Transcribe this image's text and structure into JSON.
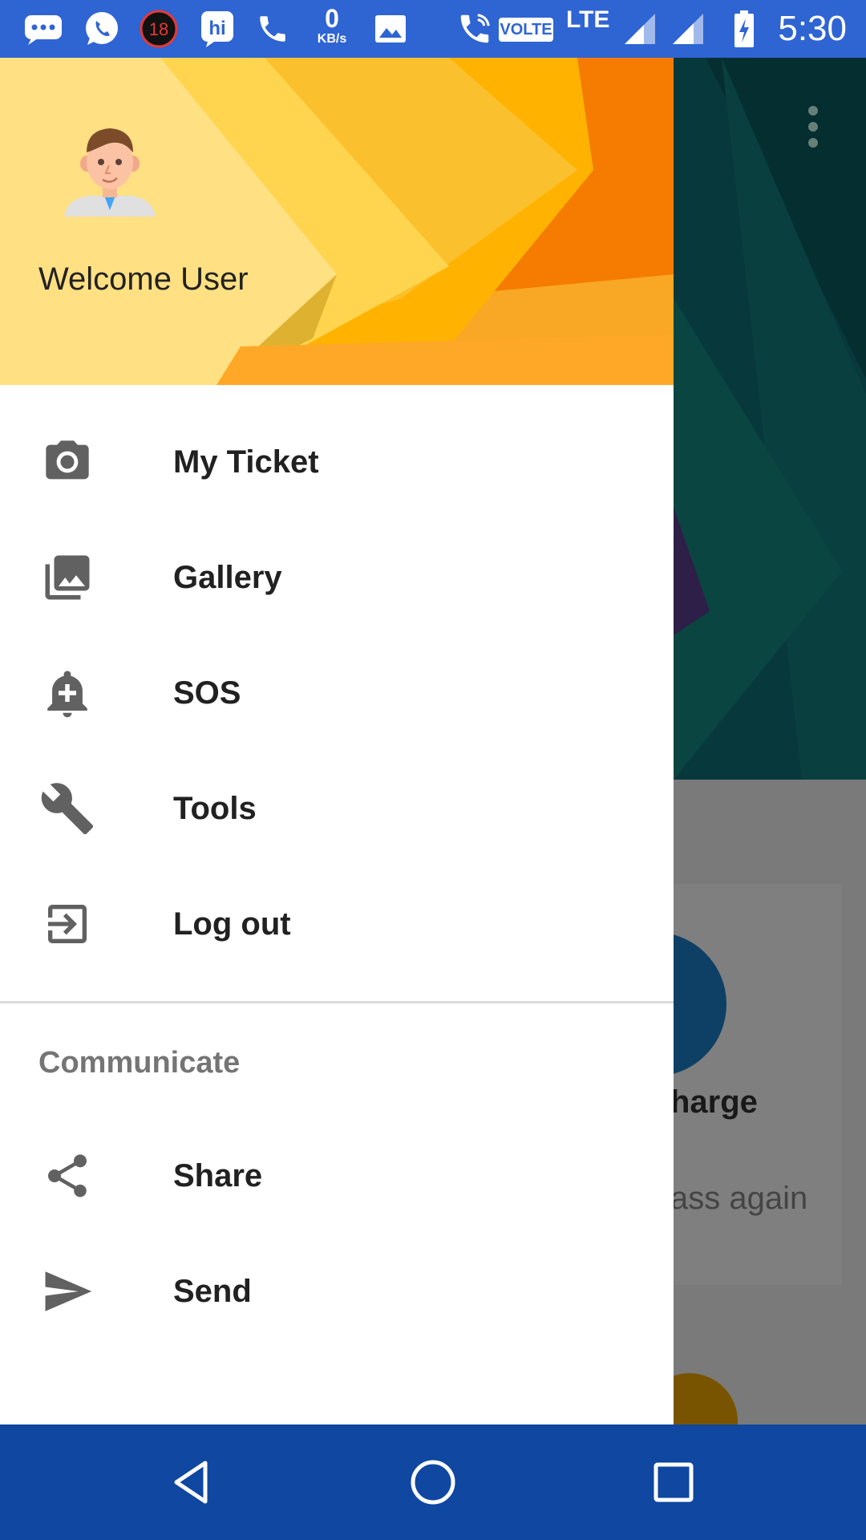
{
  "status_bar": {
    "time": "5:30",
    "notification_badge": "18",
    "net_speed_value": "0",
    "net_speed_unit": "KB/s",
    "volte": "VOLTE",
    "network": "LTE",
    "icons": [
      "chat-bubble-icon",
      "whatsapp-icon",
      "badge-18-icon",
      "hi-app-icon",
      "phone-icon",
      "image-icon",
      "wifi-calling-icon",
      "signal-icon",
      "signal-icon",
      "battery-charging-icon"
    ]
  },
  "drawer": {
    "header": {
      "welcome_text": "Welcome User",
      "avatar_icon": "user-avatar-icon"
    },
    "menu": [
      {
        "label": "My Ticket",
        "icon": "camera-icon"
      },
      {
        "label": "Gallery",
        "icon": "gallery-icon"
      },
      {
        "label": "SOS",
        "icon": "alarm-add-icon"
      },
      {
        "label": "Tools",
        "icon": "wrench-icon"
      },
      {
        "label": "Log out",
        "icon": "exit-icon"
      }
    ],
    "section_title": "Communicate",
    "communicate": [
      {
        "label": "Share",
        "icon": "share-icon"
      },
      {
        "label": "Send",
        "icon": "send-icon"
      }
    ]
  },
  "background": {
    "partial_text_1": "harge",
    "partial_text_2": "ass again"
  },
  "nav_bar": {
    "buttons": [
      "back-icon",
      "home-icon",
      "recents-icon"
    ]
  },
  "colors": {
    "status_bar": "#2f64d3",
    "nav_bar": "#0f47a1",
    "icon_gray": "#616161",
    "text_dark": "#212121",
    "section_gray": "#757575"
  }
}
